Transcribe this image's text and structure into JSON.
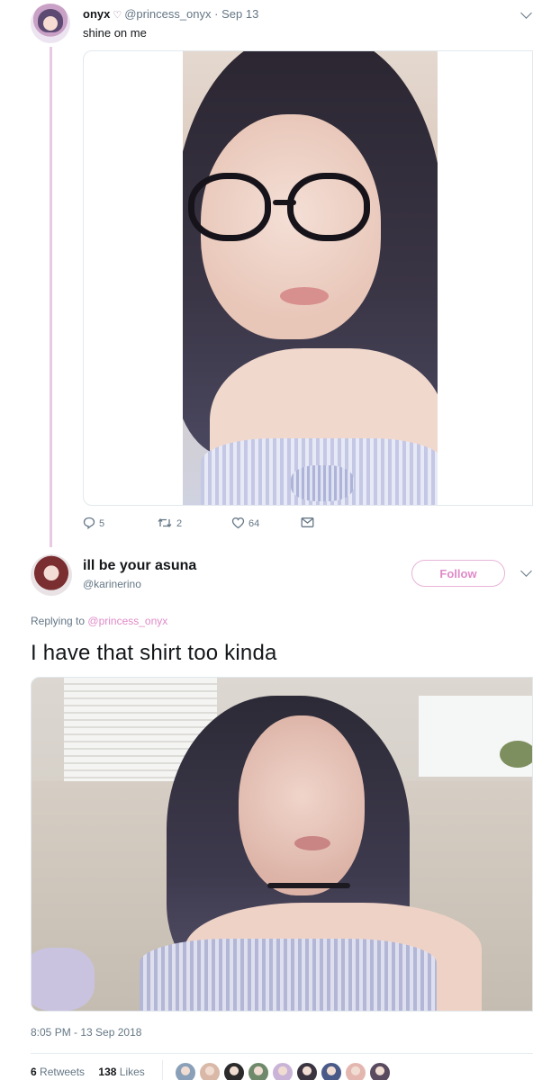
{
  "tweet1": {
    "name": "onyx",
    "name_symbol": "♡",
    "handle": "@princess_onyx",
    "dot": "·",
    "date": "Sep 13",
    "text": "shine on me",
    "actions": {
      "replies": "5",
      "retweets": "2",
      "likes": "64"
    }
  },
  "tweet2": {
    "name": "ill be your asuna",
    "handle": "@karinerino",
    "follow_label": "Follow",
    "replying_prefix": "Replying to",
    "replying_to": "@princess_onyx",
    "text": "I have that shirt too kinda",
    "timestamp": "8:05 PM - 13 Sep 2018",
    "retweets_count": "6",
    "retweets_label": "Retweets",
    "likes_count": "138",
    "likes_label": "Likes"
  },
  "icons": {
    "reply": "reply-icon",
    "retweet": "retweet-icon",
    "like": "heart-icon",
    "message": "envelope-icon",
    "more": "chevron-down-icon"
  },
  "colors": {
    "accent": "#e08ac8",
    "thread_line": "#e9c9e4",
    "secondary_text": "#657786"
  },
  "liker_colors": [
    "#8aa0b8",
    "#d9b8a8",
    "#2b2b2b",
    "#6f8a6a",
    "#c9b4d8",
    "#3a3440",
    "#4a5a88",
    "#e3b7b0",
    "#5a4a60"
  ]
}
